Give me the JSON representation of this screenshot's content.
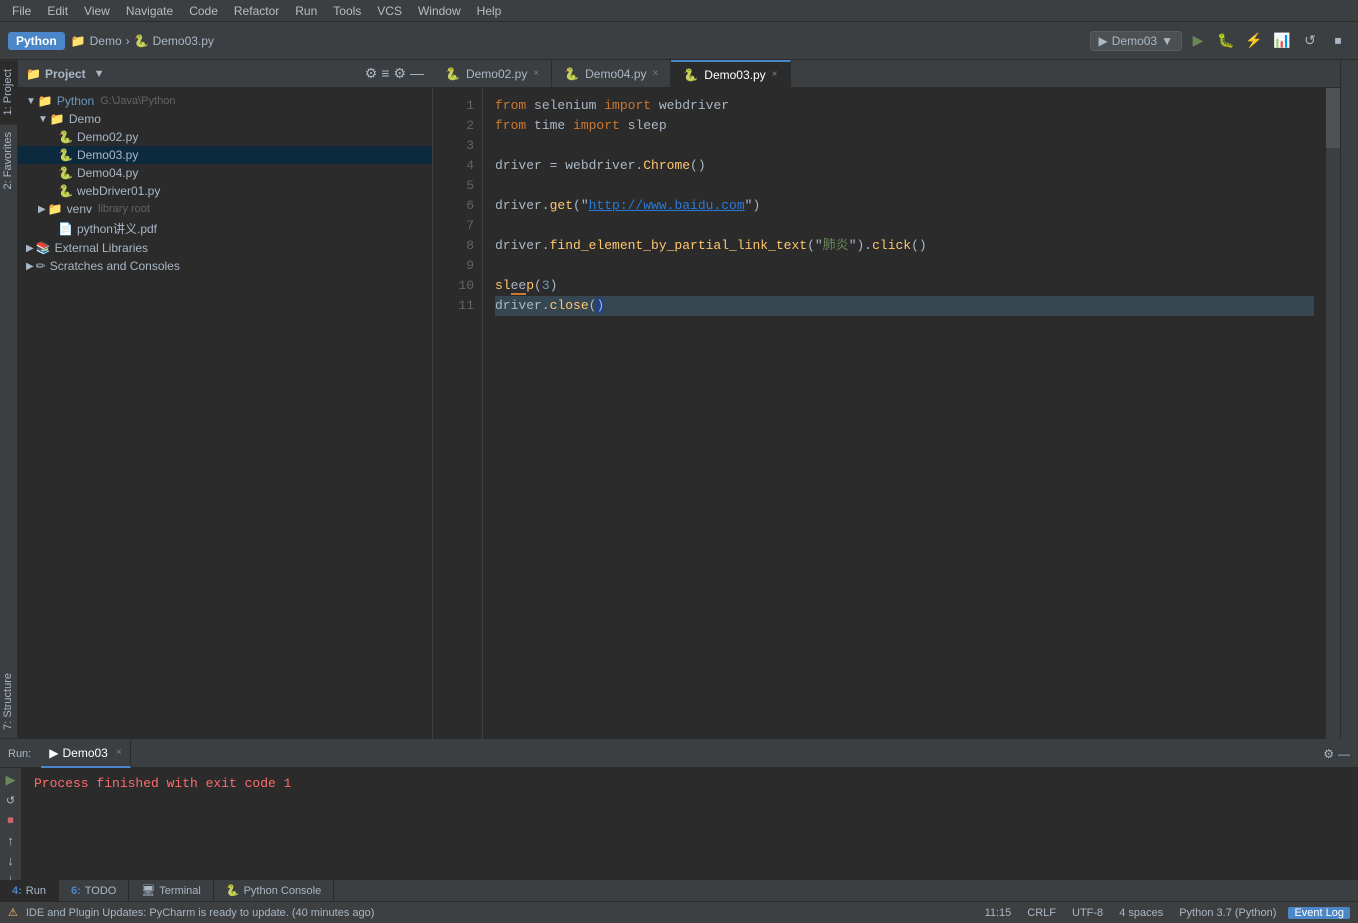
{
  "menu": {
    "items": [
      "File",
      "Edit",
      "View",
      "Navigate",
      "Code",
      "Refactor",
      "Run",
      "Tools",
      "VCS",
      "Window",
      "Help"
    ]
  },
  "toolbar": {
    "logo": "Python",
    "breadcrumb_project": "Demo",
    "breadcrumb_file": "Demo03.py",
    "run_config": "Demo03",
    "run_config_dropdown": "▼"
  },
  "project_panel": {
    "title": "Project",
    "root_label": "Python",
    "root_path": "G:\\Java\\Python",
    "items": [
      {
        "label": "Demo",
        "type": "folder",
        "level": 1,
        "expanded": true
      },
      {
        "label": "Demo02.py",
        "type": "py",
        "level": 2,
        "selected": false
      },
      {
        "label": "Demo03.py",
        "type": "py",
        "level": 2,
        "selected": true
      },
      {
        "label": "Demo04.py",
        "type": "py",
        "level": 2,
        "selected": false
      },
      {
        "label": "webDriver01.py",
        "type": "py",
        "level": 2,
        "selected": false
      },
      {
        "label": "venv",
        "type": "folder",
        "level": 1,
        "expanded": false,
        "extra": "library root"
      },
      {
        "label": "python讲义.pdf",
        "type": "pdf",
        "level": 2,
        "selected": false
      },
      {
        "label": "External Libraries",
        "type": "lib",
        "level": 0,
        "expanded": false
      },
      {
        "label": "Scratches and Consoles",
        "type": "scratch",
        "level": 0,
        "expanded": false
      }
    ]
  },
  "tabs": [
    {
      "label": "Demo02.py",
      "active": false,
      "icon": "py"
    },
    {
      "label": "Demo04.py",
      "active": false,
      "icon": "py"
    },
    {
      "label": "Demo03.py",
      "active": true,
      "icon": "py"
    }
  ],
  "editor": {
    "lines": [
      {
        "num": 1,
        "content": "from selenium import webdriver",
        "tokens": [
          {
            "text": "from ",
            "cls": "kw"
          },
          {
            "text": "selenium ",
            "cls": "id"
          },
          {
            "text": "import ",
            "cls": "kw"
          },
          {
            "text": "webdriver",
            "cls": "id"
          }
        ]
      },
      {
        "num": 2,
        "content": "from time import sleep",
        "tokens": [
          {
            "text": "from ",
            "cls": "kw"
          },
          {
            "text": "time ",
            "cls": "id"
          },
          {
            "text": "import ",
            "cls": "kw"
          },
          {
            "text": "sleep",
            "cls": "id"
          }
        ]
      },
      {
        "num": 3,
        "content": "",
        "tokens": []
      },
      {
        "num": 4,
        "content": "driver = webdriver.Chrome()",
        "tokens": [
          {
            "text": "driver ",
            "cls": "id"
          },
          {
            "text": "= ",
            "cls": "id"
          },
          {
            "text": "webdriver",
            "cls": "id"
          },
          {
            "text": ".",
            "cls": "id"
          },
          {
            "text": "Chrome",
            "cls": "fn"
          },
          {
            "text": "()",
            "cls": "id"
          }
        ]
      },
      {
        "num": 5,
        "content": "",
        "tokens": []
      },
      {
        "num": 6,
        "content": "driver.get(\"http://www.baidu.com\")",
        "tokens": [
          {
            "text": "driver",
            "cls": "id"
          },
          {
            "text": ".",
            "cls": "id"
          },
          {
            "text": "get",
            "cls": "fn"
          },
          {
            "text": "(\"",
            "cls": "id"
          },
          {
            "text": "http://www.baidu.com",
            "cls": "url"
          },
          {
            "text": "\")",
            "cls": "id"
          }
        ]
      },
      {
        "num": 7,
        "content": "",
        "tokens": []
      },
      {
        "num": 8,
        "content": "driver.find_element_by_partial_link_text(\"肺炎\").click()",
        "tokens": [
          {
            "text": "driver",
            "cls": "id"
          },
          {
            "text": ".",
            "cls": "id"
          },
          {
            "text": "find_element_by_partial_link_text",
            "cls": "fn"
          },
          {
            "text": "(\"",
            "cls": "id"
          },
          {
            "text": "肺炎",
            "cls": "str"
          },
          {
            "text": "\")",
            "cls": "id"
          },
          {
            "text": ".",
            "cls": "id"
          },
          {
            "text": "click",
            "cls": "fn"
          },
          {
            "text": "()",
            "cls": "id"
          }
        ]
      },
      {
        "num": 9,
        "content": "",
        "tokens": []
      },
      {
        "num": 10,
        "content": "sleep(3)",
        "tokens": [
          {
            "text": "sleep",
            "cls": "fn"
          },
          {
            "text": "(",
            "cls": "id"
          },
          {
            "text": "3",
            "cls": "num"
          },
          {
            "text": ")",
            "cls": "id"
          }
        ]
      },
      {
        "num": 11,
        "content": "driver.close()",
        "tokens": [
          {
            "text": "driver",
            "cls": "id"
          },
          {
            "text": ".",
            "cls": "id"
          },
          {
            "text": "close",
            "cls": "fn"
          },
          {
            "text": "()",
            "cls": "sel"
          }
        ]
      }
    ]
  },
  "run_panel": {
    "title": "Run:",
    "tab_label": "Demo03",
    "output": "Process finished with exit code 1"
  },
  "bottom_tabs": [
    {
      "num": "4",
      "label": "Run",
      "active": true
    },
    {
      "num": "6",
      "label": "TODO",
      "active": false
    },
    {
      "label": "Terminal",
      "active": false
    },
    {
      "label": "Python Console",
      "active": false
    }
  ],
  "status_bar": {
    "message": "IDE and Plugin Updates: PyCharm is ready to update. (40 minutes ago)",
    "cursor": "11:15",
    "line_sep": "CRLF",
    "encoding": "UTF-8",
    "indent": "4 spaces",
    "python_ver": "Python 3.7 (Python)",
    "event_log": "Event Log"
  },
  "left_panel_tabs": [
    {
      "label": "1: Project"
    },
    {
      "label": "2: Favorites"
    },
    {
      "label": "7: Structure"
    }
  ]
}
